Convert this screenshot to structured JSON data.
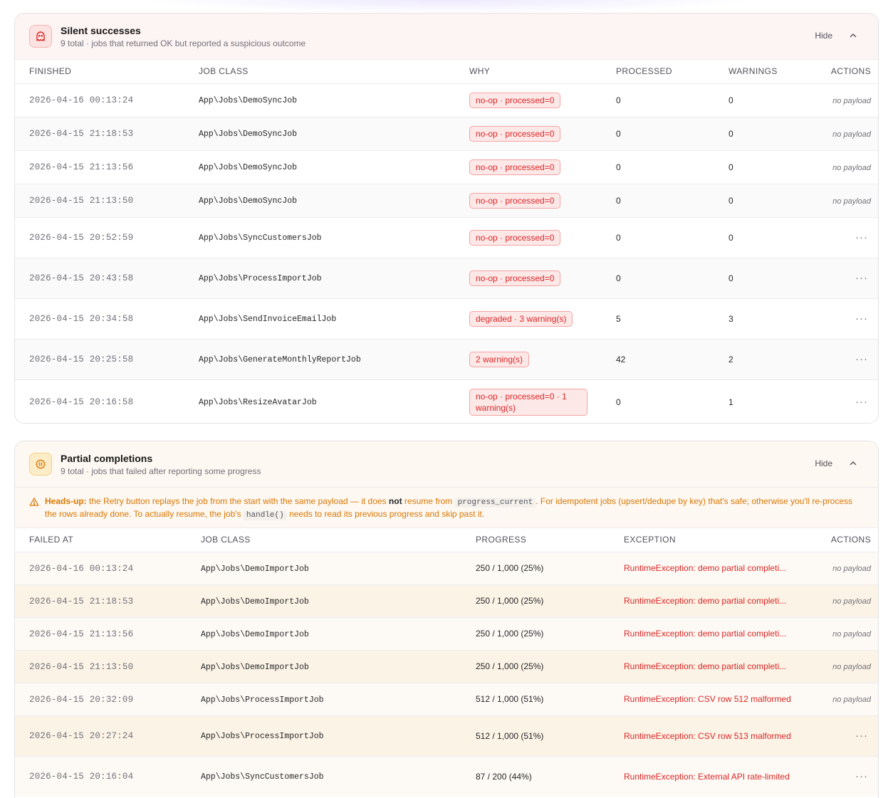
{
  "silent": {
    "title": "Silent successes",
    "subtitle": "9 total · jobs that returned OK but reported a suspicious outcome",
    "hide_label": "Hide",
    "icon": "ghost-icon",
    "accent": "#dc2626",
    "columns": [
      "FINISHED",
      "JOB CLASS",
      "WHY",
      "PROCESSED",
      "WARNINGS",
      "ACTIONS"
    ],
    "rows": [
      {
        "finished": "2026-04-16 00:13:24",
        "job": "App\\Jobs\\DemoSyncJob",
        "why": "no-op · processed=0",
        "processed": "0",
        "warnings": "0",
        "action": "no payload"
      },
      {
        "finished": "2026-04-15 21:18:53",
        "job": "App\\Jobs\\DemoSyncJob",
        "why": "no-op · processed=0",
        "processed": "0",
        "warnings": "0",
        "action": "no payload"
      },
      {
        "finished": "2026-04-15 21:13:56",
        "job": "App\\Jobs\\DemoSyncJob",
        "why": "no-op · processed=0",
        "processed": "0",
        "warnings": "0",
        "action": "no payload"
      },
      {
        "finished": "2026-04-15 21:13:50",
        "job": "App\\Jobs\\DemoSyncJob",
        "why": "no-op · processed=0",
        "processed": "0",
        "warnings": "0",
        "action": "no payload"
      },
      {
        "finished": "2026-04-15 20:52:59",
        "job": "App\\Jobs\\SyncCustomersJob",
        "why": "no-op · processed=0",
        "processed": "0",
        "warnings": "0",
        "action": "···"
      },
      {
        "finished": "2026-04-15 20:43:58",
        "job": "App\\Jobs\\ProcessImportJob",
        "why": "no-op · processed=0",
        "processed": "0",
        "warnings": "0",
        "action": "···"
      },
      {
        "finished": "2026-04-15 20:34:58",
        "job": "App\\Jobs\\SendInvoiceEmailJob",
        "why": "degraded · 3 warning(s)",
        "processed": "5",
        "warnings": "3",
        "action": "···"
      },
      {
        "finished": "2026-04-15 20:25:58",
        "job": "App\\Jobs\\GenerateMonthlyReportJob",
        "why": "2 warning(s)",
        "processed": "42",
        "warnings": "2",
        "action": "···"
      },
      {
        "finished": "2026-04-15 20:16:58",
        "job": "App\\Jobs\\ResizeAvatarJob",
        "why": "no-op · processed=0 · 1 warning(s)",
        "processed": "0",
        "warnings": "1",
        "action": "···"
      }
    ]
  },
  "partial": {
    "title": "Partial completions",
    "subtitle": "9 total · jobs that failed after reporting some progress",
    "hide_label": "Hide",
    "icon": "pause-icon",
    "accent": "#d97706",
    "headsup": {
      "label": "Heads-up:",
      "t1": "the Retry button replays the job from the start with the same payload — it does",
      "not": "not",
      "t2": "resume from",
      "code1": "progress_current",
      "t3": ". For idempotent jobs (upsert/dedupe by key) that's safe; otherwise you'll re-process the rows already done. To actually resume, the job's",
      "code2": "handle()",
      "t4": "needs to read its previous progress and skip past it."
    },
    "columns": [
      "FAILED AT",
      "JOB CLASS",
      "PROGRESS",
      "EXCEPTION",
      "ACTIONS"
    ],
    "rows": [
      {
        "failed": "2026-04-16 00:13:24",
        "job": "App\\Jobs\\DemoImportJob",
        "progress": "250 / 1,000 (25%)",
        "exception": "RuntimeException: demo partial completi...",
        "action": "no payload"
      },
      {
        "failed": "2026-04-15 21:18:53",
        "job": "App\\Jobs\\DemoImportJob",
        "progress": "250 / 1,000 (25%)",
        "exception": "RuntimeException: demo partial completi...",
        "action": "no payload"
      },
      {
        "failed": "2026-04-15 21:13:56",
        "job": "App\\Jobs\\DemoImportJob",
        "progress": "250 / 1,000 (25%)",
        "exception": "RuntimeException: demo partial completi...",
        "action": "no payload"
      },
      {
        "failed": "2026-04-15 21:13:50",
        "job": "App\\Jobs\\DemoImportJob",
        "progress": "250 / 1,000 (25%)",
        "exception": "RuntimeException: demo partial completi...",
        "action": "no payload"
      },
      {
        "failed": "2026-04-15 20:32:09",
        "job": "App\\Jobs\\ProcessImportJob",
        "progress": "512 / 1,000 (51%)",
        "exception": "RuntimeException: CSV row 512 malformed",
        "action": "no payload"
      },
      {
        "failed": "2026-04-15 20:27:24",
        "job": "App\\Jobs\\ProcessImportJob",
        "progress": "512 / 1,000 (51%)",
        "exception": "RuntimeException: CSV row 513 malformed",
        "action": "···"
      },
      {
        "failed": "2026-04-15 20:16:04",
        "job": "App\\Jobs\\SyncCustomersJob",
        "progress": "87 / 200 (44%)",
        "exception": "RuntimeException: External API rate-limited",
        "action": "···"
      }
    ]
  }
}
